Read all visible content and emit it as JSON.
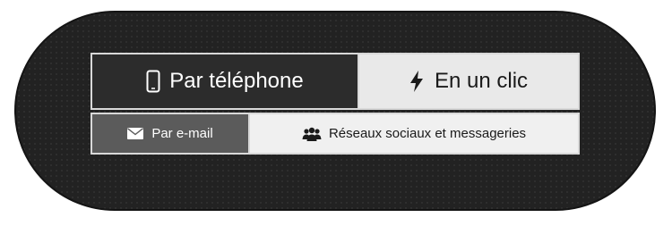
{
  "contact_methods": {
    "primary": [
      {
        "label": "Par téléphone",
        "icon": "mobile-phone-icon",
        "selected": true
      },
      {
        "label": "En un clic",
        "icon": "lightning-bolt-icon",
        "selected": false
      }
    ],
    "secondary": [
      {
        "label": "Par e-mail",
        "icon": "envelope-icon",
        "selected": true
      },
      {
        "label": "Réseaux sociaux et messageries",
        "icon": "users-icon",
        "selected": false
      }
    ]
  },
  "colors": {
    "background": "#222222",
    "selected_primary": "#2c2c2c",
    "selected_secondary": "#5b5b5b",
    "unselected": "#e9e9e9",
    "border": "#d9d9d9"
  }
}
